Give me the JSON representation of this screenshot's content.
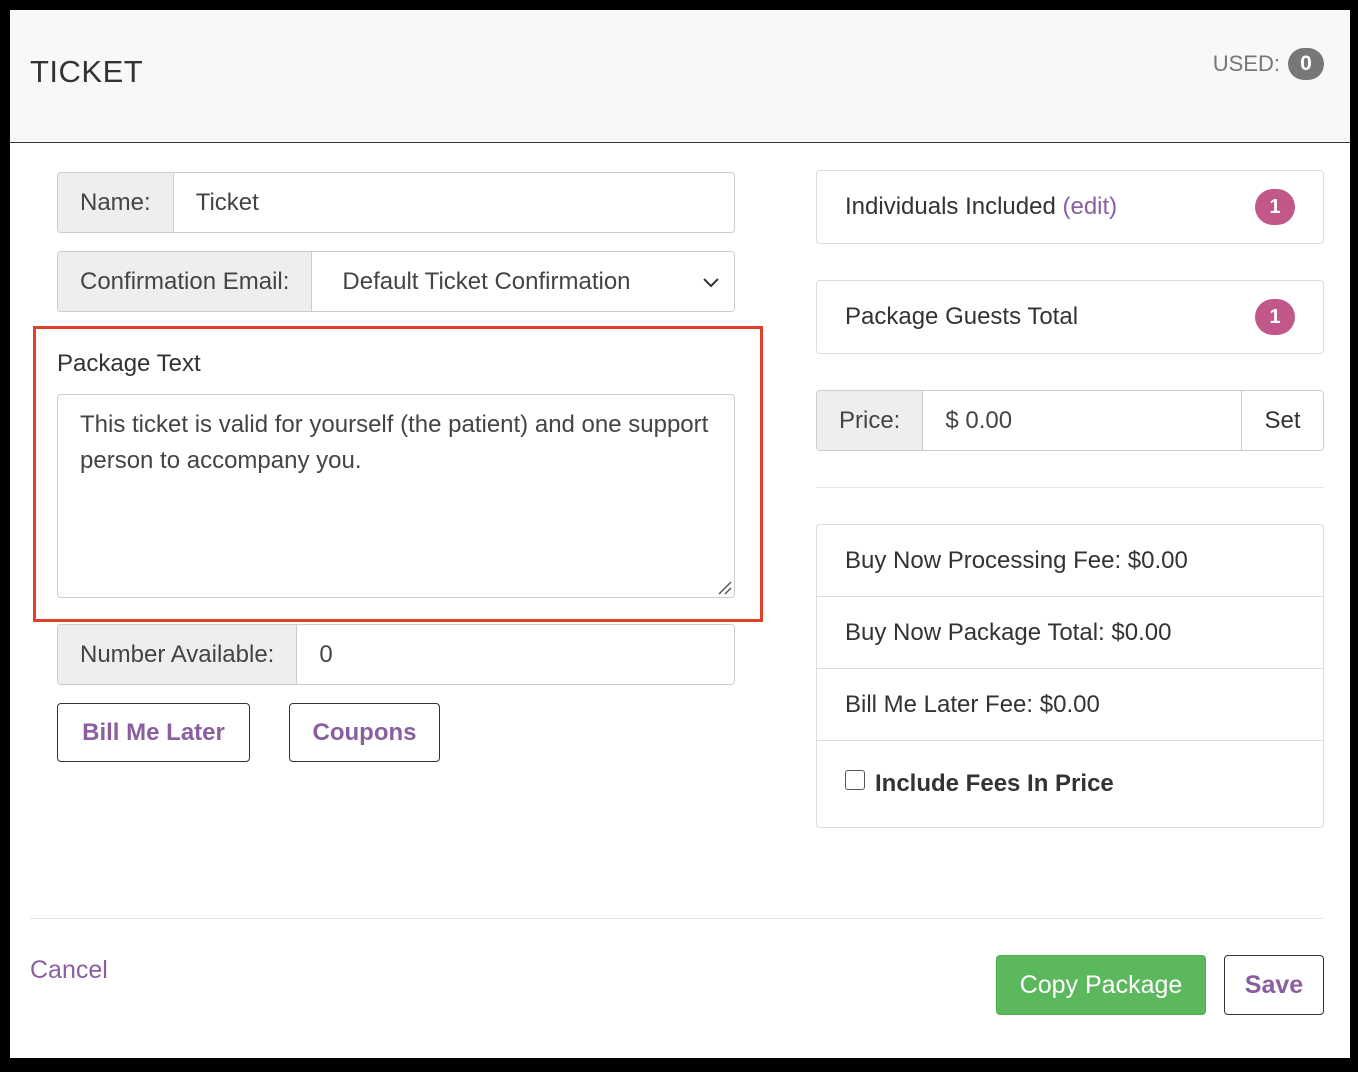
{
  "header": {
    "title": "TICKET",
    "used_label": "USED:",
    "used_count": "0"
  },
  "form": {
    "name_label": "Name:",
    "name_value": "Ticket",
    "confirmation_label": "Confirmation Email:",
    "confirmation_value": "Default Ticket Confirmation",
    "package_text_label": "Package Text",
    "package_text_value": "This ticket is valid for yourself (the patient) and one support person to accompany you.",
    "number_available_label": "Number Available:",
    "number_available_value": "0",
    "bill_me_later_label": "Bill Me Later",
    "coupons_label": "Coupons"
  },
  "summary": {
    "individuals_label": "Individuals Included",
    "individuals_edit": "(edit)",
    "individuals_count": "1",
    "guests_total_label": "Package Guests Total",
    "guests_total_count": "1",
    "price_label": "Price:",
    "price_value": "$ 0.00",
    "set_label": "Set",
    "fees": {
      "processing_fee": "Buy Now Processing Fee: $0.00",
      "package_total": "Buy Now Package Total: $0.00",
      "bill_later_fee": "Bill Me Later Fee: $0.00",
      "include_fees_label": "Include Fees In Price"
    }
  },
  "footer": {
    "cancel_label": "Cancel",
    "copy_label": "Copy Package",
    "save_label": "Save"
  },
  "colors": {
    "accent_purple": "#8a5fa0",
    "badge_pink": "#c2578a",
    "success_green": "#5cb85c",
    "highlight_red": "#e0412b"
  }
}
